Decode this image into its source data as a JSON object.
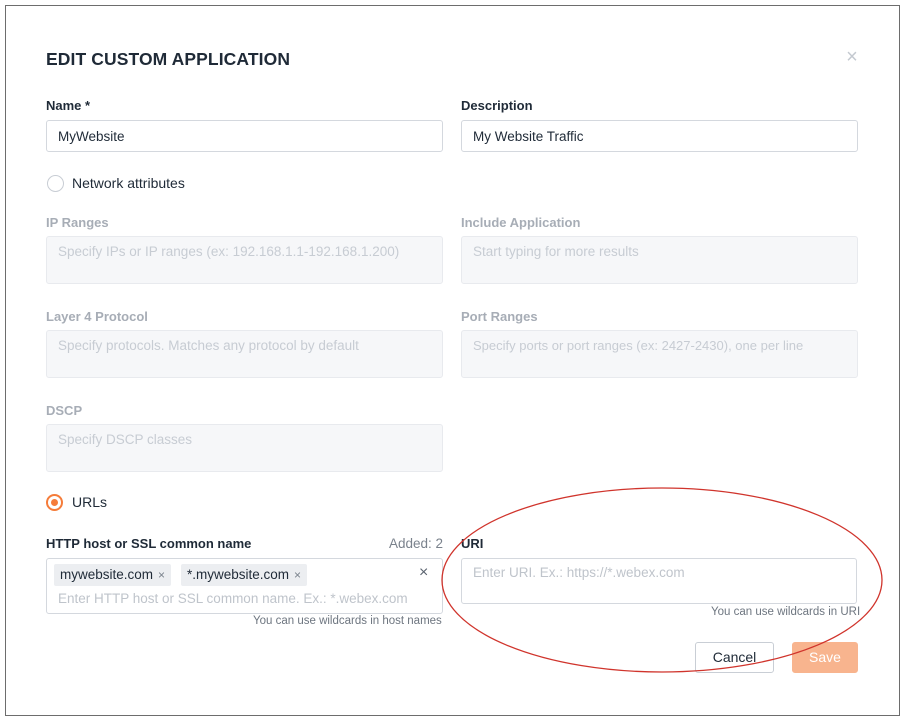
{
  "modal": {
    "title": "EDIT CUSTOM APPLICATION",
    "close_icon": "close-icon"
  },
  "name": {
    "label": "Name *",
    "value": "MyWebsite"
  },
  "description": {
    "label": "Description",
    "value": "My Website Traffic"
  },
  "network_attributes": {
    "label": "Network attributes",
    "selected": false
  },
  "ip_ranges": {
    "label": "IP Ranges",
    "placeholder": "Specify IPs or IP ranges (ex: 192.168.1.1-192.168.1.200)"
  },
  "include_application": {
    "label": "Include Application",
    "placeholder": "Start typing for more results"
  },
  "layer4_protocol": {
    "label": "Layer 4 Protocol",
    "placeholder": "Specify protocols. Matches any protocol by default"
  },
  "port_ranges": {
    "label": "Port Ranges",
    "placeholder": "Specify ports or port ranges (ex: 2427-2430), one per line"
  },
  "dscp": {
    "label": "DSCP",
    "placeholder": "Specify DSCP classes"
  },
  "urls": {
    "label": "URLs",
    "selected": true
  },
  "http_host": {
    "label": "HTTP host or SSL common name",
    "added": "Added: 2",
    "tags": [
      {
        "text": "mywebsite.com",
        "remove": "×"
      },
      {
        "text": "*.mywebsite.com",
        "remove": "×"
      }
    ],
    "clear": "×",
    "placeholder": "Enter HTTP host or SSL common name. Ex.: *.webex.com",
    "hint": "You can use wildcards in host names"
  },
  "uri": {
    "label": "URI",
    "placeholder": "Enter URI. Ex.: https://*.webex.com",
    "hint": "You can use wildcards in URI"
  },
  "buttons": {
    "cancel": "Cancel",
    "save": "Save"
  },
  "colors": {
    "accent": "#f57c3a",
    "save_disabled": "#f8b48e",
    "annotation_ellipse": "#d0342c"
  }
}
